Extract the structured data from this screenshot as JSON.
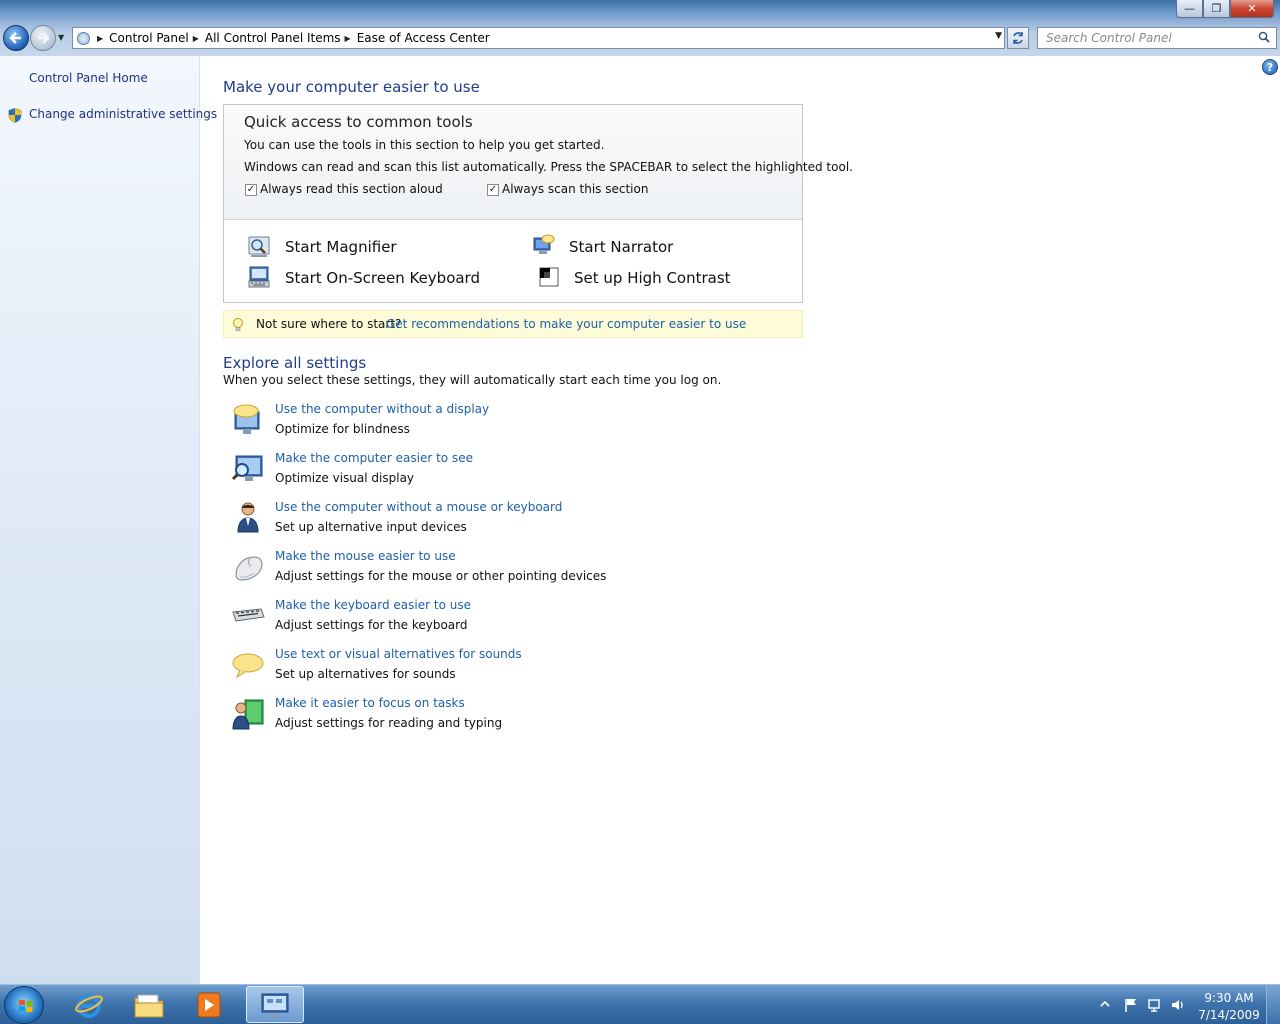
{
  "window": {
    "minimize_glyph": "—",
    "restore_glyph": "❐",
    "close_glyph": "✕"
  },
  "addressbar": {
    "crumbs": [
      "Control Panel",
      "All Control Panel Items",
      "Ease of Access Center"
    ]
  },
  "search": {
    "placeholder": "Search Control Panel"
  },
  "left_pane": {
    "links": [
      "Control Panel Home",
      "Change administrative settings"
    ]
  },
  "main": {
    "title": "Make your computer easier to use",
    "quick_access": {
      "title": "Quick access to common tools",
      "line1": "You can use the tools in this section to help you get started.",
      "line2": "Windows can read and scan this list automatically.  Press the SPACEBAR to select the highlighted tool.",
      "checkbox_read": {
        "label": "Always read this section aloud",
        "checked": true
      },
      "checkbox_scan": {
        "label": "Always scan this section",
        "checked": true
      },
      "tools": [
        "Start Magnifier",
        "Start Narrator",
        "Start On-Screen Keyboard",
        "Set up High Contrast"
      ]
    },
    "tip": {
      "text": "Not sure where to start?",
      "link": "Get recommendations to make your computer easier to use"
    },
    "explore": {
      "title": "Explore all settings",
      "description": "When you select these settings, they will automatically start each time you log on.",
      "items": [
        {
          "link": "Use the computer without a display",
          "desc": "Optimize for blindness",
          "icon": "speech-monitor-icon"
        },
        {
          "link": "Make the computer easier to see",
          "desc": "Optimize visual display",
          "icon": "magnifier-monitor-icon"
        },
        {
          "link": "Use the computer without a mouse or keyboard",
          "desc": "Set up alternative input devices",
          "icon": "person-icon"
        },
        {
          "link": "Make the mouse easier to use",
          "desc": "Adjust settings for the mouse or other pointing devices",
          "icon": "mouse-icon"
        },
        {
          "link": "Make the keyboard easier to use",
          "desc": "Adjust settings for the keyboard",
          "icon": "keyboard-icon"
        },
        {
          "link": "Use text or visual alternatives for sounds",
          "desc": "Set up alternatives for sounds",
          "icon": "speech-bubble-icon"
        },
        {
          "link": "Make it easier to focus on tasks",
          "desc": "Adjust settings for reading and typing",
          "icon": "focus-person-icon"
        }
      ]
    }
  },
  "taskbar": {
    "time": "9:30 AM",
    "date": "7/14/2009"
  },
  "colors": {
    "link": "#1f5fa8",
    "heading": "#1e3d8a",
    "tip_background": "#fdfbd8"
  }
}
